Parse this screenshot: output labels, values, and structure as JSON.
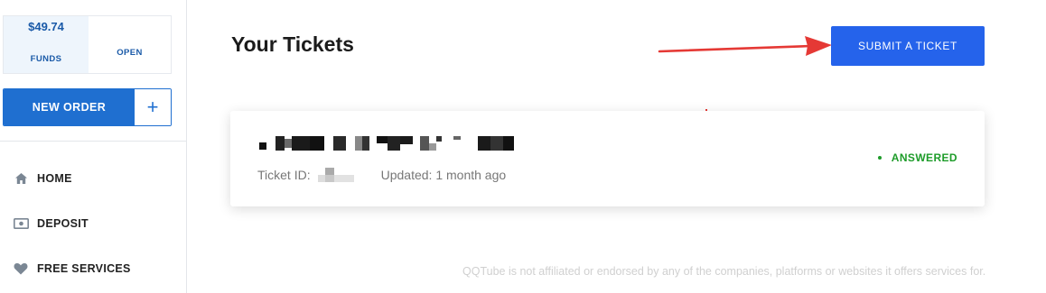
{
  "sidebar": {
    "funds_amount": "$49.74",
    "funds_label": "FUNDS",
    "open_label": "OPEN",
    "new_order_label": "NEW ORDER",
    "new_order_plus": "+",
    "items": [
      {
        "label": "HOME",
        "icon": "home-icon"
      },
      {
        "label": "DEPOSIT",
        "icon": "deposit-icon"
      },
      {
        "label": "FREE SERVICES",
        "icon": "heart-icon"
      }
    ]
  },
  "main": {
    "title": "Your Tickets",
    "submit_label": "SUBMIT A TICKET",
    "ticket": {
      "id_label": "Ticket ID:",
      "updated": "Updated: 1 month ago",
      "status": "ANSWERED"
    },
    "footer_note": "QQTube is not affiliated or endorsed by any of the companies, platforms or websites it offers services for."
  },
  "colors": {
    "accent": "#2563eb",
    "sidebar_accent": "#1f6fd0",
    "status": "#1e9c2a",
    "arrow": "#e53935"
  }
}
